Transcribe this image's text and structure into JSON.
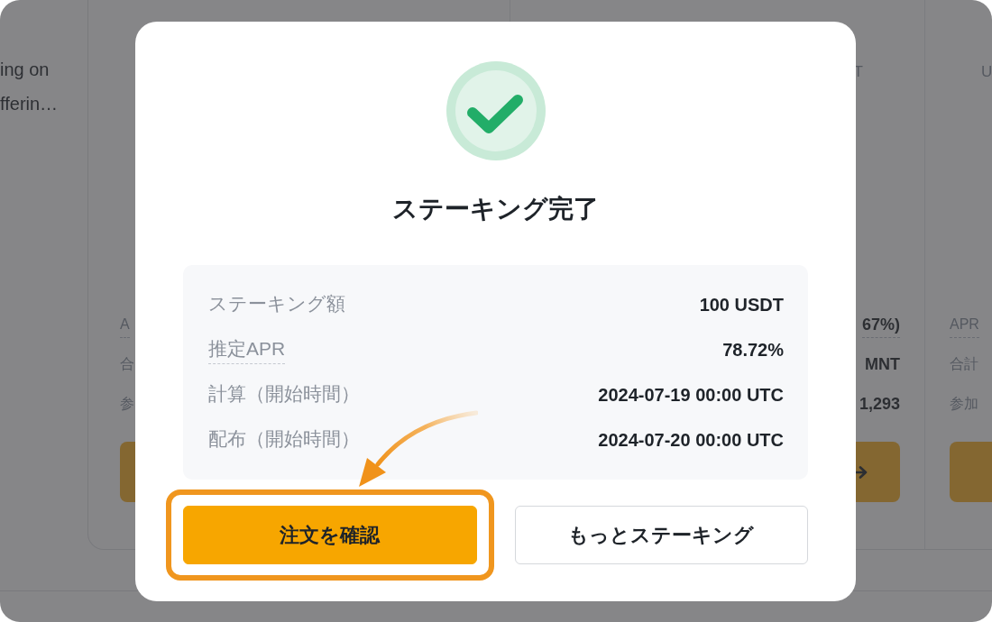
{
  "background_page": {
    "description_lines": [
      "ing on",
      "fferin…"
    ],
    "cards": [
      {
        "stats": [
          {
            "label": "A",
            "label_dashed": true
          },
          {
            "label": "合",
            "label_dashed": false
          },
          {
            "label": "参",
            "label_dashed": false
          }
        ],
        "button_arrow": false
      },
      {
        "top_right_text": "T",
        "stats": [
          {
            "value": "67%)",
            "value_dashed": true
          },
          {
            "value": "MNT",
            "value_dashed": false
          },
          {
            "value": "1,293",
            "value_dashed": false
          }
        ],
        "button_arrow": true
      },
      {
        "top_left_text": "U",
        "stats": [
          {
            "label": "APR",
            "label_dashed": true
          },
          {
            "label": "合計",
            "label_dashed": false
          },
          {
            "label": "参加",
            "label_dashed": false
          }
        ],
        "button_arrow": false
      }
    ]
  },
  "dialog": {
    "title": "ステーキング完了",
    "details": [
      {
        "label": "ステーキング額",
        "value": "100 USDT",
        "label_dashed": false
      },
      {
        "label": "推定APR",
        "value": "78.72%",
        "label_dashed": true
      },
      {
        "label": "計算（開始時間）",
        "value": "2024-07-19 00:00 UTC",
        "label_dashed": false
      },
      {
        "label": "配布（開始時間）",
        "value": "2024-07-20 00:00 UTC",
        "label_dashed": false
      }
    ],
    "buttons": [
      {
        "label": "注文を確認",
        "kind": "primary",
        "highlighted": true
      },
      {
        "label": "もっとステーキング",
        "kind": "secondary",
        "highlighted": false
      }
    ]
  }
}
